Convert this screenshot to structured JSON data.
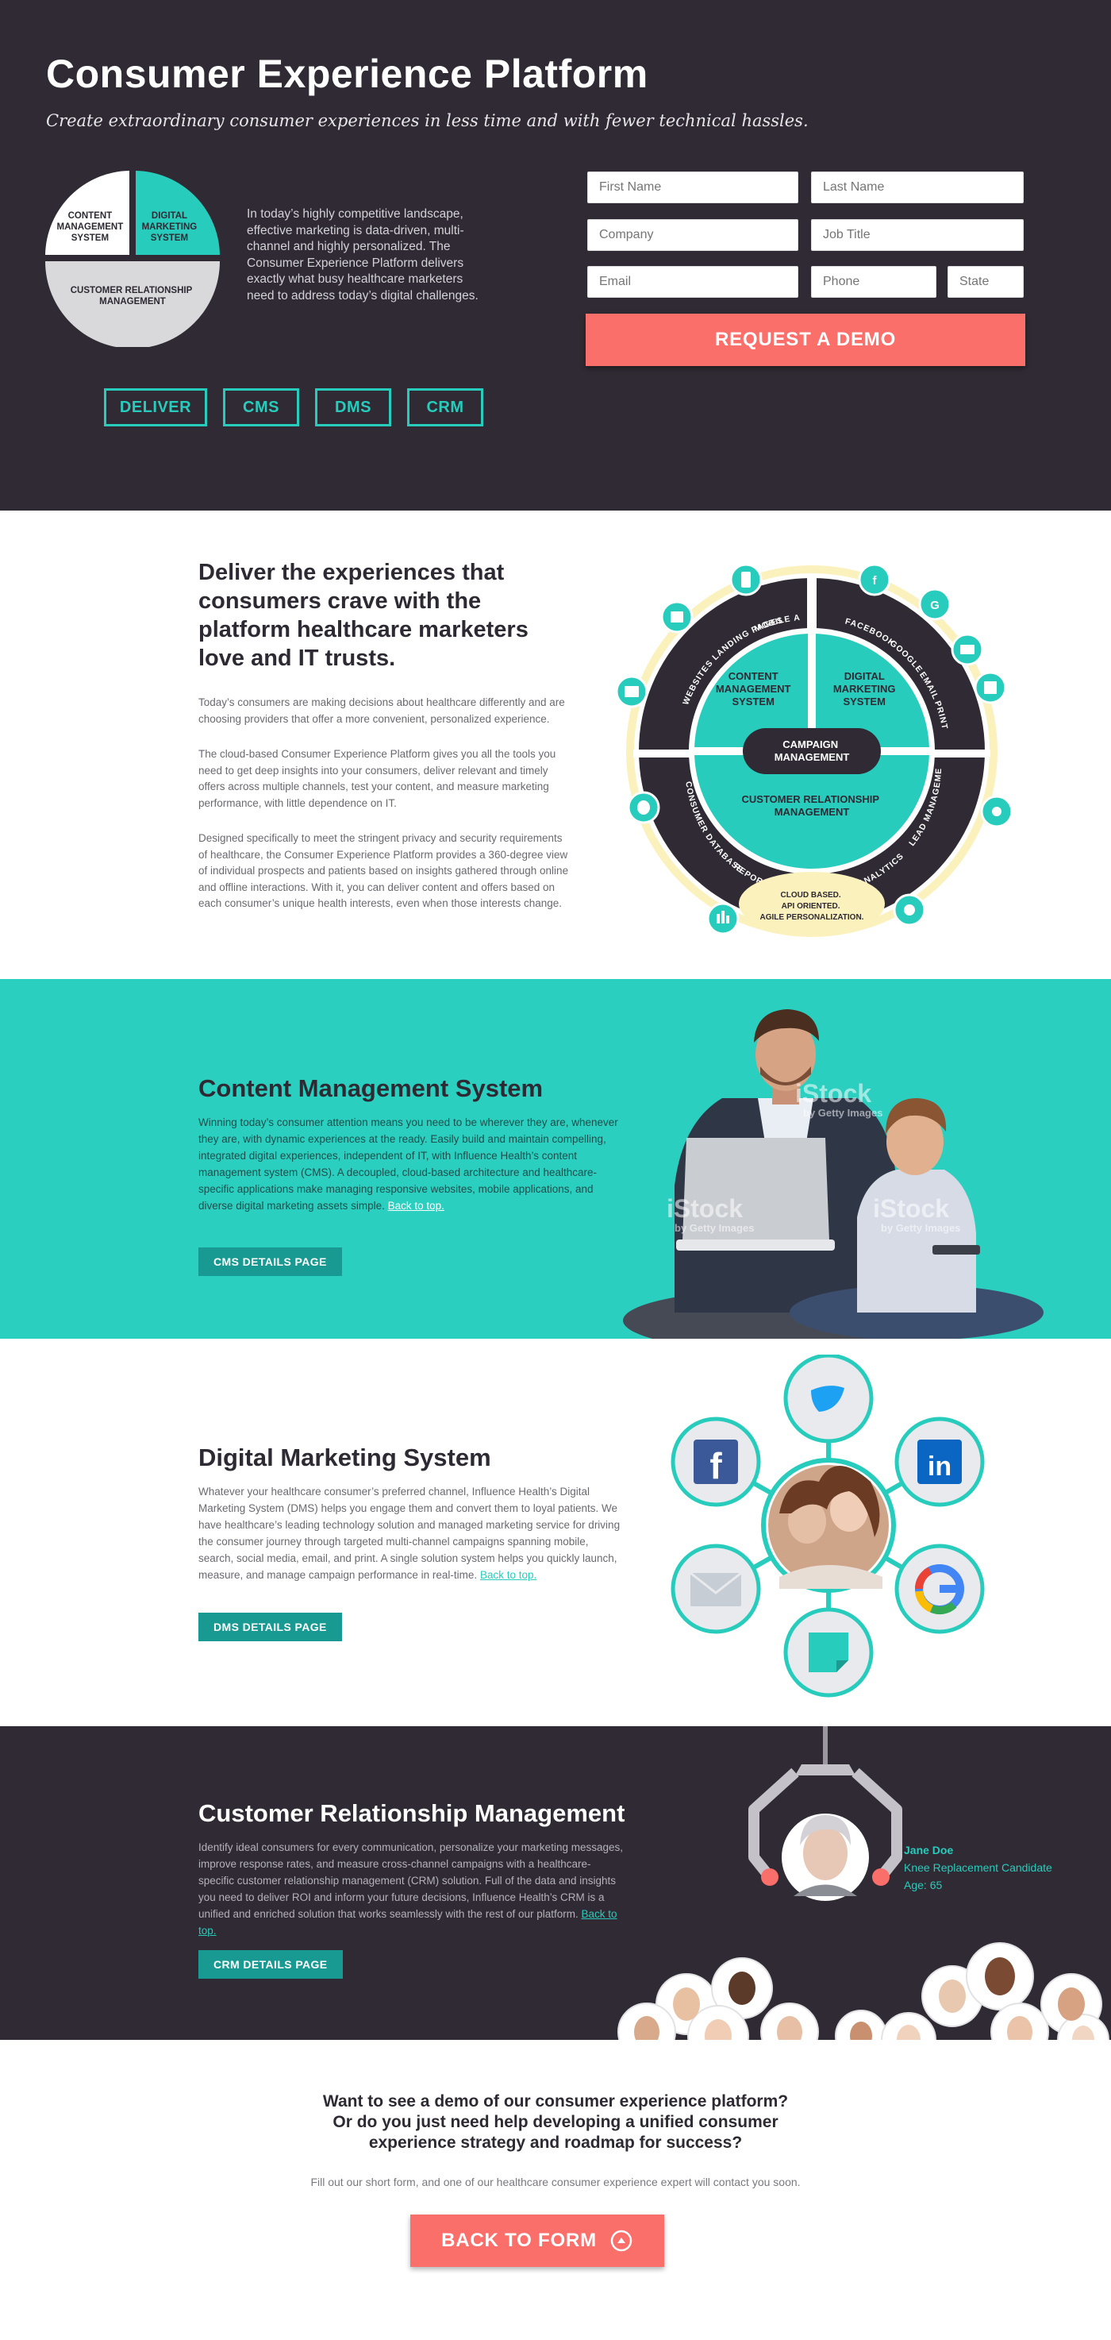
{
  "hero": {
    "title": "Consumer Experience Platform",
    "subtitle": "Create extraordinary consumer experiences in less time and with fewer technical hassles.",
    "pie": {
      "cms": [
        "CONTENT",
        "MANAGEMENT",
        "SYSTEM"
      ],
      "dms": [
        "DIGITAL",
        "MARKETING",
        "SYSTEM"
      ],
      "crm": [
        "CUSTOMER RELATIONSHIP",
        "MANAGEMENT"
      ]
    },
    "description": "In today’s highly competitive landscape, effective marketing is data-driven, multi-channel and highly personalized. The Consumer Experience Platform delivers exactly what busy healthcare marketers need to address today’s digital challenges.",
    "pills": [
      "DELIVER",
      "CMS",
      "DMS",
      "CRM"
    ],
    "form": {
      "first_name": "First Name",
      "last_name": "Last Name",
      "company": "Company",
      "job_title": "Job Title",
      "email": "Email",
      "phone": "Phone",
      "state": "State",
      "submit": "REQUEST A DEMO"
    },
    "colors": {
      "teal": "#28ccbc",
      "dark": "#2f2a33",
      "coral": "#fb6f6b"
    }
  },
  "deliver": {
    "heading": "Deliver the experiences that consumers crave with the platform healthcare marketers love and IT trusts.",
    "p1": "Today’s consumers are making decisions about healthcare differently and are choosing providers that offer a more convenient, personalized experience.",
    "p2": "The cloud-based Consumer Experience Platform gives you all the tools you need to get deep insights into your consumers, deliver relevant and timely offers across multiple channels, test your content, and measure marketing performance, with little dependence on IT.",
    "p3": "Designed specifically to meet the stringent privacy and security requirements of healthcare, the Consumer Experience Platform provides a 360-degree view of individual prospects and patients based on insights gathered through online and offline interactions. With it, you can deliver content and offers based on each consumer’s unique health interests, even when those interests change.",
    "wheel": {
      "cms": [
        "CONTENT",
        "MANAGEMENT",
        "SYSTEM"
      ],
      "dms": [
        "DIGITAL",
        "MARKETING",
        "SYSTEM"
      ],
      "crm": [
        "CUSTOMER RELATIONSHIP",
        "MANAGEMENT"
      ],
      "campaign": [
        "CAMPAIGN",
        "MANAGEMENT"
      ],
      "ring": [
        "MOBILE APPS",
        "LANDING PAGES",
        "WEBSITES",
        "FACEBOOK",
        "GOOGLE",
        "EMAIL",
        "PRINT",
        "LEAD MANAGEMENT",
        "ANALYTICS",
        "CONSUMER DATABASE",
        "REPORTING"
      ],
      "cloud": [
        "CLOUD BASED.",
        "API ORIENTED.",
        "AGILE PERSONALIZATION."
      ]
    }
  },
  "cms": {
    "heading": "Content Management System",
    "text": "Winning today’s consumer attention means you need to be wherever they are, whenever they are, with dynamic experiences at the ready. Easily build and maintain compelling, integrated digital experiences, independent of IT, with Influence Health’s content management system (CMS). A decoupled, cloud-based architecture and healthcare-specific applications make managing responsive websites, mobile applications, and diverse digital marketing assets simple.",
    "back": "Back to top.",
    "button": "CMS DETAILS PAGE",
    "watermark": "iStock",
    "watermark_sub": "by Getty Images"
  },
  "dms": {
    "heading": "Digital Marketing System",
    "text": "Whatever your healthcare consumer’s preferred channel, Influence Health’s Digital Marketing System (DMS) helps you engage them and convert them to loyal patients. We have healthcare’s leading technology solution and managed marketing service for driving the consumer journey through targeted multi-channel campaigns spanning mobile, search, social media, email, and print. A single solution system helps you quickly launch, measure, and manage campaign performance in real-time.",
    "back": "Back to top.",
    "button": "DMS DETAILS PAGE"
  },
  "crm": {
    "heading": "Customer Relationship Management",
    "text": "Identify ideal consumers for every communication, personalize your marketing messages, improve response rates, and measure cross-channel campaigns with a healthcare-specific customer relationship management (CRM) solution. Full of the data and insights you need to deliver ROI and inform your future decisions, Influence Health’s CRM is a unified and enriched solution that works seamlessly with the rest of our platform.",
    "back": "Back to top.",
    "button": "CRM DETAILS PAGE",
    "profile_name": "Jane Doe",
    "profile_detail": "Knee Replacement Candidate",
    "profile_age": "Age: 65"
  },
  "cta": {
    "heading_1": "Want to see a demo of our consumer experience platform?",
    "heading_2": "Or do you just need help developing a unified consumer",
    "heading_3": "experience strategy and roadmap for success?",
    "text": "Fill out our short form, and one of our healthcare consumer experience expert will contact you soon.",
    "button": "BACK TO FORM"
  }
}
